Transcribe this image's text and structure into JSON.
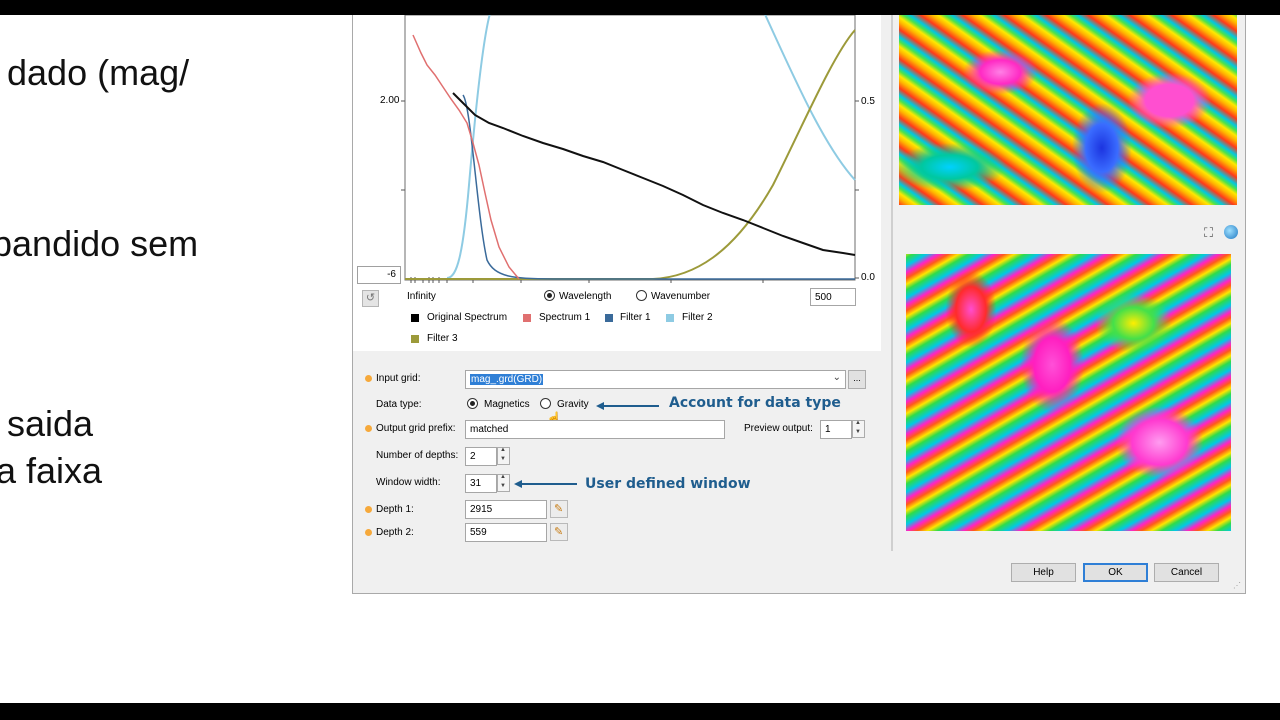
{
  "slide": {
    "lines": [
      "dado (mag/",
      "bandido sem",
      "saida",
      "a faixa"
    ]
  },
  "chart": {
    "left_ytick": "2.00",
    "right_ytick_top": "0.5",
    "right_ytick_bottom": "0.0",
    "min_value": "-6",
    "x_start_label": "Infinity",
    "x_mode_options": [
      "Wavelength",
      "Wavenumber"
    ],
    "x_mode_selected": "Wavelength",
    "x_end_value": "500",
    "legend": [
      {
        "label": "Original Spectrum",
        "color": "#000000"
      },
      {
        "label": "Spectrum 1",
        "color": "#e07070"
      },
      {
        "label": "Filter 1",
        "color": "#3a6a9a"
      },
      {
        "label": "Filter 2",
        "color": "#8ecbe3"
      },
      {
        "label": "Filter 3",
        "color": "#9c9a3a"
      }
    ]
  },
  "form": {
    "input_grid": {
      "label": "Input grid:",
      "value": "mag_.grd(GRD)"
    },
    "data_type": {
      "label": "Data type:",
      "options": [
        "Magnetics",
        "Gravity"
      ],
      "selected": "Magnetics"
    },
    "output_prefix": {
      "label": "Output grid prefix:",
      "value": "matched"
    },
    "preview_output": {
      "label": "Preview output:",
      "value": "1"
    },
    "num_depths": {
      "label": "Number of depths:",
      "value": "2"
    },
    "window_width": {
      "label": "Window width:",
      "value": "31"
    },
    "depth1": {
      "label": "Depth 1:",
      "value": "2915"
    },
    "depth2": {
      "label": "Depth 2:",
      "value": "559"
    },
    "browse_label": "..."
  },
  "annotations": {
    "data_type_note": "Account for data type",
    "window_note": "User defined window"
  },
  "buttons": {
    "help": "Help",
    "ok": "OK",
    "cancel": "Cancel"
  },
  "colors": {
    "annotation": "#1f5d8e",
    "required_marker": "#f6a93b",
    "ok_border": "#2f7fd6"
  }
}
